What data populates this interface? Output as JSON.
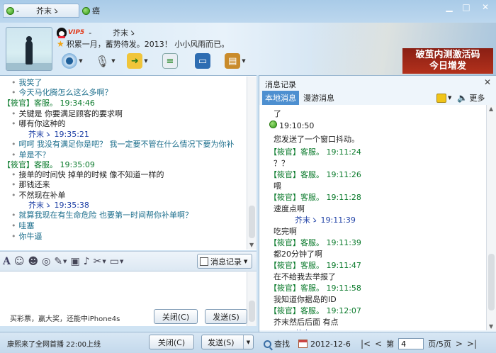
{
  "tabs": {
    "self_name": "芥末ゝ",
    "self_dash": "-",
    "other_name": "癌"
  },
  "window": {
    "minimize": "▁",
    "maximize": "□",
    "close": "✕"
  },
  "profile": {
    "vip_label": "VIP5",
    "dash": "-",
    "name": "芥末ゝ",
    "signature": "积累一月，蓄势待发。2013！ 小小风雨而已。"
  },
  "ad": {
    "line1": "破茧内测激活码",
    "line2": "今日增发"
  },
  "chat": [
    {
      "kind": "msg",
      "text": "我笑了"
    },
    {
      "kind": "msg",
      "text": "今天马化腾怎么这么多啊？"
    },
    {
      "kind": "svc",
      "text": "【筱官】客服。 19:34:46"
    },
    {
      "kind": "dark",
      "text": "关键是  你要满足顾客的要求啊"
    },
    {
      "kind": "dark",
      "text": "哪有你这种的"
    },
    {
      "kind": "me",
      "text": "芥末ゝ   19:35:21"
    },
    {
      "kind": "msg",
      "text": "呵呵  我没有满足你是吧？ 我一定要不管在什么情况下要为你补"
    },
    {
      "kind": "msg",
      "text": "单是不？"
    },
    {
      "kind": "svc",
      "text": "【筱官】客服。 19:35:09"
    },
    {
      "kind": "dark",
      "text": "接单的时间快  掉单的时候  像不知道一样的"
    },
    {
      "kind": "dark",
      "text": "那钱还来"
    },
    {
      "kind": "dark",
      "text": "不然现在补单"
    },
    {
      "kind": "me",
      "text": "芥末ゝ   19:35:38"
    },
    {
      "kind": "msg",
      "text": "就算我现在有生命危险  也要第一时间帮你补单啊？"
    },
    {
      "kind": "msg",
      "text": "哇塞"
    },
    {
      "kind": "msg",
      "text": "你牛逼"
    }
  ],
  "format_bar": {
    "record_button": "消息记录"
  },
  "input": {
    "ad_text": "买彩票，赢大奖，还能中iPhone4s",
    "close_button": "关闭(C)",
    "send_button": "发送(S)"
  },
  "bottom": {
    "announcement": "康熙来了全网首播 22:00上线",
    "close_button": "关闭(C)",
    "send_button": "发送(S)"
  },
  "record_panel": {
    "title": "消息记录",
    "tab_local": "本地消息",
    "tab_roam": "漫游消息",
    "more": "更多",
    "log": [
      {
        "kind": "txt",
        "text": "了"
      },
      {
        "kind": "sys",
        "text": "19:10:50"
      },
      {
        "kind": "txt",
        "text": "您发送了一个窗口抖动。"
      },
      {
        "kind": "svc",
        "text": "【筱官】客服。 19:11:24"
      },
      {
        "kind": "txt",
        "text": "？？"
      },
      {
        "kind": "svc",
        "text": "【筱官】客服。 19:11:26"
      },
      {
        "kind": "txt",
        "text": "喂"
      },
      {
        "kind": "svc",
        "text": "【筱官】客服。 19:11:28"
      },
      {
        "kind": "txt",
        "text": "速度点啊"
      },
      {
        "kind": "me",
        "text": "芥末ゝ 19:11:39"
      },
      {
        "kind": "txt",
        "text": "吃完啊"
      },
      {
        "kind": "svc",
        "text": "【筱官】客服。 19:11:39"
      },
      {
        "kind": "txt",
        "text": "都20分钟了啊"
      },
      {
        "kind": "svc",
        "text": "【筱官】客服。 19:11:47"
      },
      {
        "kind": "txt",
        "text": "在不给我去举报了"
      },
      {
        "kind": "svc",
        "text": "【筱官】客服。 19:11:58"
      },
      {
        "kind": "txt",
        "text": "我知道你据岛的ID"
      },
      {
        "kind": "svc",
        "text": "【筱官】客服。 19:12:07"
      },
      {
        "kind": "txt",
        "text": "芥末然后后面  有点"
      },
      {
        "kind": "me",
        "text": "芥末ゝ 19:12:18"
      }
    ],
    "search": "查找",
    "date": "2012-12-6",
    "page_prefix": "第",
    "page_value": "4",
    "page_suffix": "页/5页"
  }
}
